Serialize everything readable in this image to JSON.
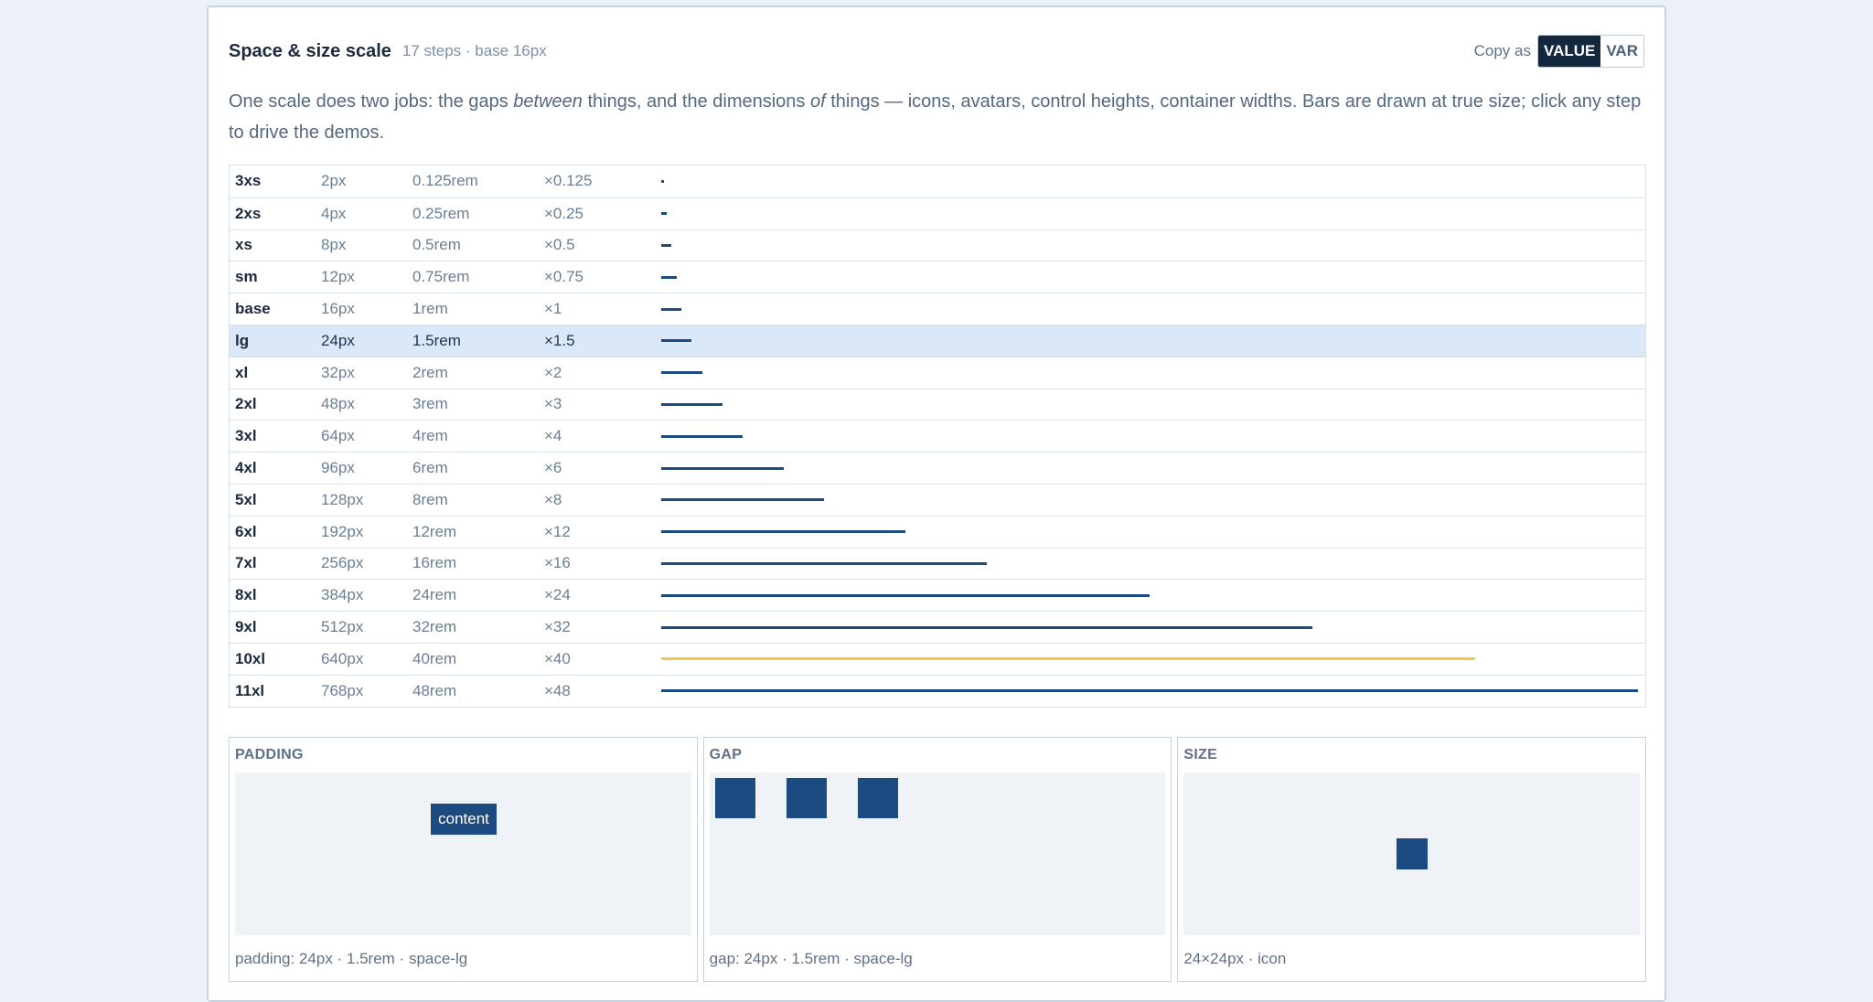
{
  "header": {
    "title": "Space & size scale",
    "subtitle": "17 steps · base 16px",
    "copy_label": "Copy as",
    "copy_options": [
      "VALUE",
      "VAR"
    ],
    "copy_selected": "VALUE"
  },
  "description": {
    "part1": "One scale does two jobs: the gaps ",
    "em1": "between",
    "part2": " things, and the dimensions ",
    "em2": "of",
    "part3": " things — icons, avatars, control heights, container widths. Bars are drawn at true size; click any step to drive the demos."
  },
  "scale": {
    "selected": "lg",
    "highlight": "10xl",
    "bar_color": "#1c4b82",
    "highlight_color": "#f3c94e",
    "steps": [
      {
        "name": "3xs",
        "px": "2px",
        "rem": "0.125rem",
        "mult": "×0.125",
        "value": 2
      },
      {
        "name": "2xs",
        "px": "4px",
        "rem": "0.25rem",
        "mult": "×0.25",
        "value": 4
      },
      {
        "name": "xs",
        "px": "8px",
        "rem": "0.5rem",
        "mult": "×0.5",
        "value": 8
      },
      {
        "name": "sm",
        "px": "12px",
        "rem": "0.75rem",
        "mult": "×0.75",
        "value": 12
      },
      {
        "name": "base",
        "px": "16px",
        "rem": "1rem",
        "mult": "×1",
        "value": 16
      },
      {
        "name": "lg",
        "px": "24px",
        "rem": "1.5rem",
        "mult": "×1.5",
        "value": 24
      },
      {
        "name": "xl",
        "px": "32px",
        "rem": "2rem",
        "mult": "×2",
        "value": 32
      },
      {
        "name": "2xl",
        "px": "48px",
        "rem": "3rem",
        "mult": "×3",
        "value": 48
      },
      {
        "name": "3xl",
        "px": "64px",
        "rem": "4rem",
        "mult": "×4",
        "value": 64
      },
      {
        "name": "4xl",
        "px": "96px",
        "rem": "6rem",
        "mult": "×6",
        "value": 96
      },
      {
        "name": "5xl",
        "px": "128px",
        "rem": "8rem",
        "mult": "×8",
        "value": 128
      },
      {
        "name": "6xl",
        "px": "192px",
        "rem": "12rem",
        "mult": "×12",
        "value": 192
      },
      {
        "name": "7xl",
        "px": "256px",
        "rem": "16rem",
        "mult": "×16",
        "value": 256
      },
      {
        "name": "8xl",
        "px": "384px",
        "rem": "24rem",
        "mult": "×24",
        "value": 384
      },
      {
        "name": "9xl",
        "px": "512px",
        "rem": "32rem",
        "mult": "×32",
        "value": 512
      },
      {
        "name": "10xl",
        "px": "640px",
        "rem": "40rem",
        "mult": "×40",
        "value": 640
      },
      {
        "name": "11xl",
        "px": "768px",
        "rem": "48rem",
        "mult": "×48",
        "value": 768
      }
    ]
  },
  "demos": {
    "padding": {
      "title": "PADDING",
      "content_label": "content",
      "caption": "padding: 24px · 1.5rem · space-lg"
    },
    "gap": {
      "title": "GAP",
      "caption": "gap: 24px · 1.5rem · space-lg"
    },
    "size": {
      "title": "SIZE",
      "caption": "24×24px · icon"
    }
  }
}
